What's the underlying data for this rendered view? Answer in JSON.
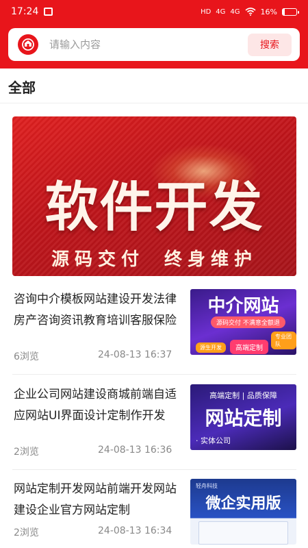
{
  "status_bar": {
    "time": "17:24",
    "network_1": "HD",
    "network_2": "4G",
    "network_3": "4G",
    "battery": "16%"
  },
  "search": {
    "placeholder": "请输入内容",
    "button_label": "搜索"
  },
  "section": {
    "title": "全部"
  },
  "banner": {
    "title": "软件开发",
    "subtitle": "源码交付 终身维护"
  },
  "news": [
    {
      "title": "咨询中介模板网站建设开发法律房产咨询资讯教育培训客服保险",
      "views": "6浏览",
      "time": "24-08-13 16:37",
      "thumb": {
        "heading": "中介网站",
        "pill": "源码交付 不满意全额退",
        "chip_left": "源生开发",
        "chip_mid": "高端定制",
        "chip_right": "专业团队"
      }
    },
    {
      "title": "企业公司网站建设商城前端自适应网站UI界面设计定制作开发",
      "views": "2浏览",
      "time": "24-08-13 16:36",
      "thumb": {
        "top_text": "高端定制 | 品质保障",
        "heading": "网站定制",
        "bottom_text": "· 实体公司"
      }
    },
    {
      "title": "网站定制开发网站前端开发网站建设企业官方网站定制",
      "views": "2浏览",
      "time": "24-08-13 16:34",
      "thumb": {
        "brand": "轻舟科技",
        "heading": "微企实用版"
      }
    }
  ],
  "colors": {
    "brand_red": "#e8151b",
    "button_bg": "#fde6e6",
    "meta_gray": "#888888"
  }
}
